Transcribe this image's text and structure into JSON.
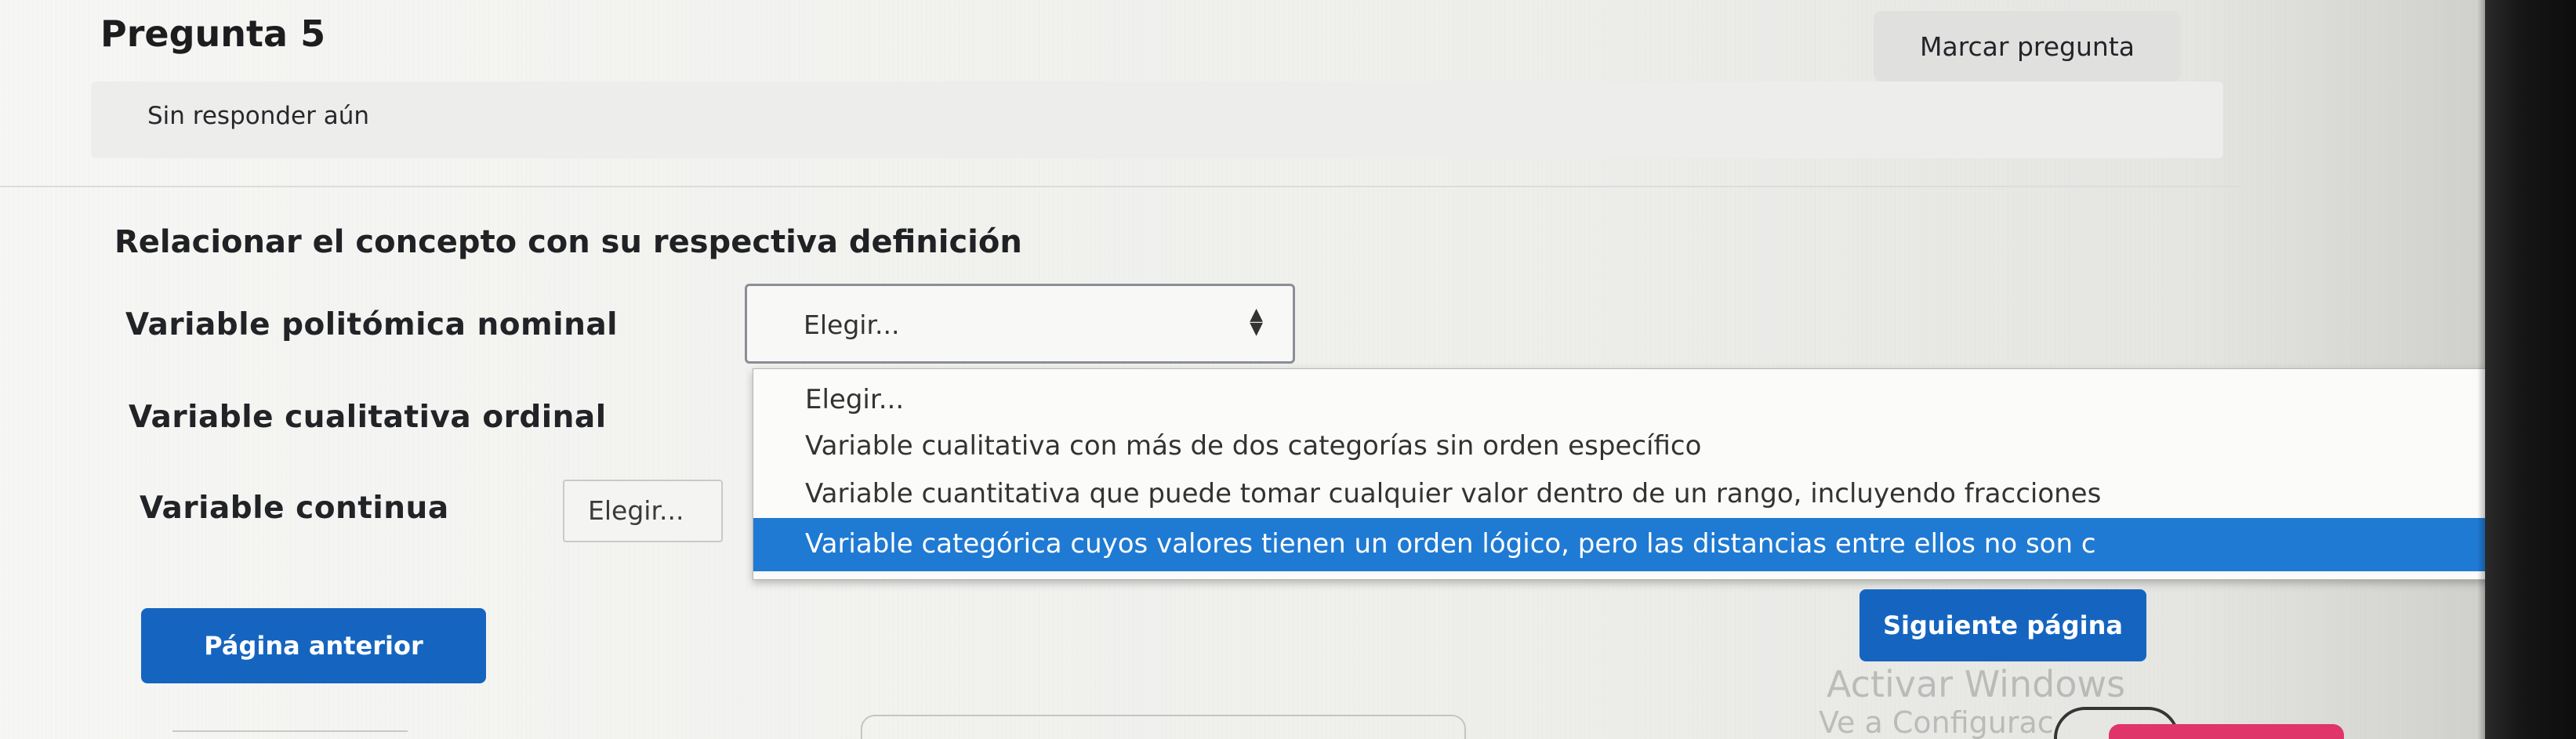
{
  "question": {
    "title": "Pregunta 5",
    "status": "Sin responder aún",
    "flag_label": "Marcar pregunta",
    "instruction": "Relacionar el concepto con su respectiva definición"
  },
  "match_rows": [
    {
      "label": "Variable politómica nominal",
      "selected": "Elegir..."
    },
    {
      "label": "Variable cualitativa ordinal",
      "selected": ""
    },
    {
      "label": "Variable continua",
      "selected": "Elegir..."
    }
  ],
  "dropdown": {
    "options": [
      "Elegir...",
      "Variable cualitativa con más de dos categorías sin orden específico",
      "Variable cuantitativa que puede tomar cualquier valor dentro de un rango, incluyendo fracciones",
      "Variable categórica cuyos valores tienen un orden lógico, pero las distancias entre ellos no son c"
    ],
    "highlighted_index": 3
  },
  "nav": {
    "prev_label": "Página anterior",
    "next_label": "Siguiente página"
  },
  "watermark": {
    "line1": "Activar Windows",
    "line2": "Ve a Configurac"
  },
  "colors": {
    "accent": "#1565c0",
    "highlight": "#1f7ad3"
  }
}
